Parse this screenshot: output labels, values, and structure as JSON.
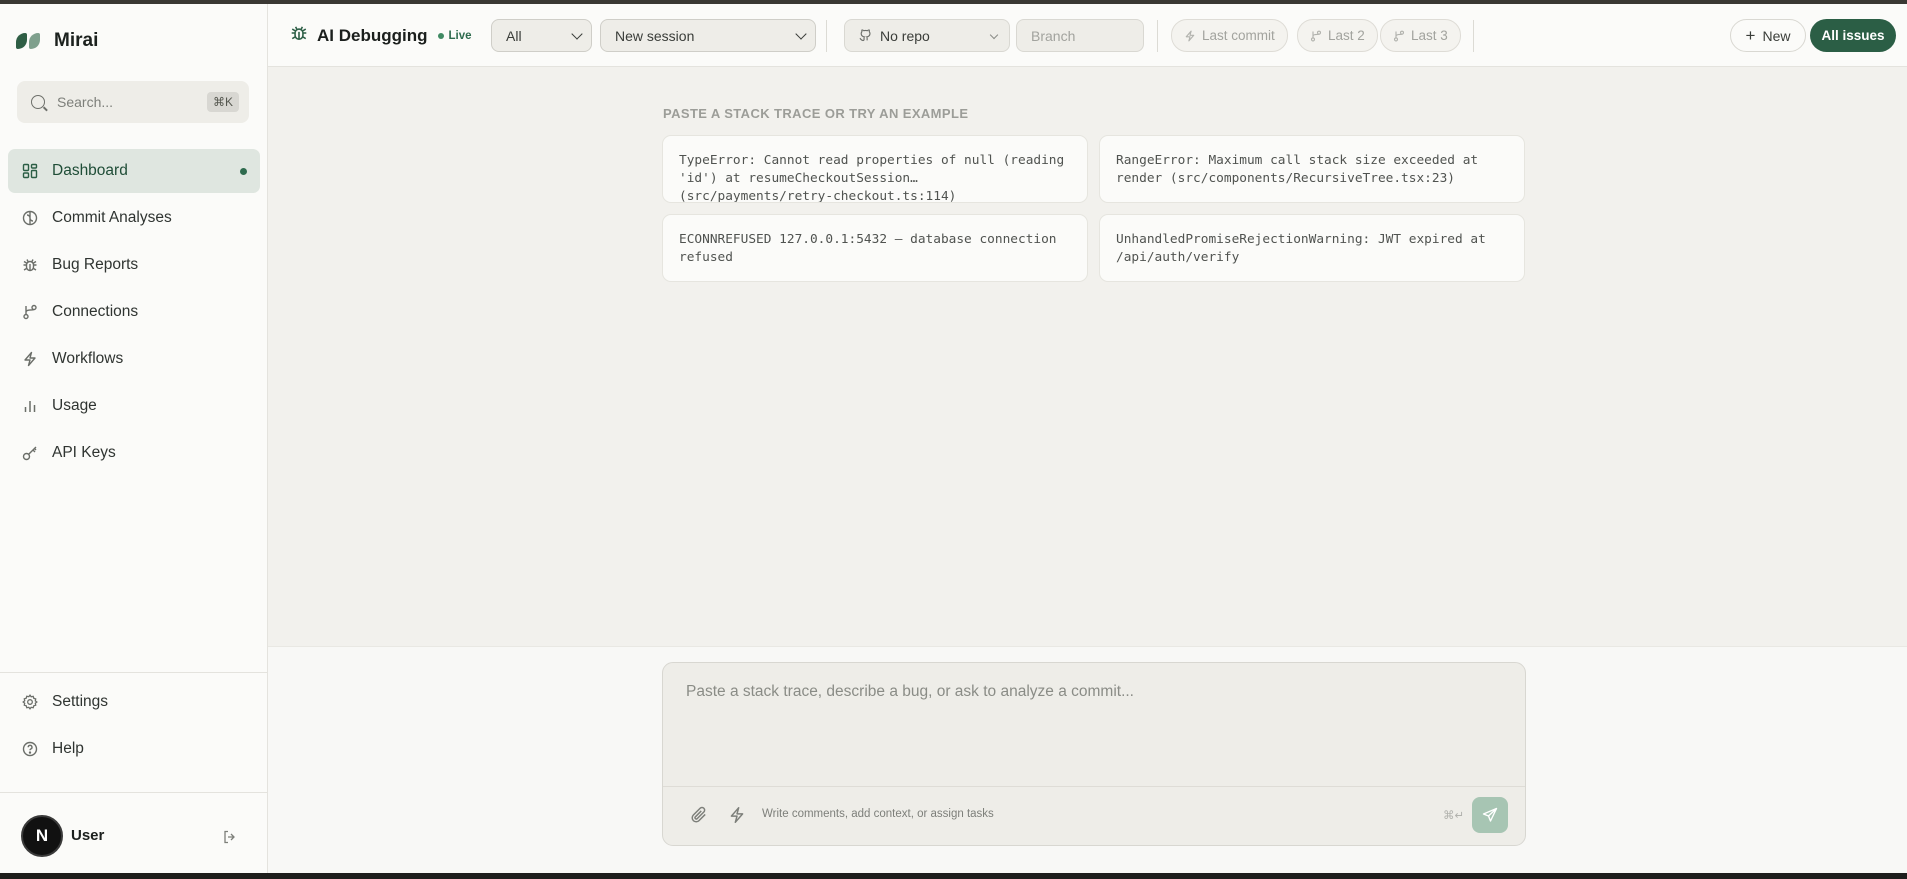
{
  "brand": {
    "name": "Mirai",
    "colors": {
      "accent": "#2b5e45",
      "accent_light": "#7fa08d"
    }
  },
  "search": {
    "placeholder": "Search...",
    "shortcut": "⌘K"
  },
  "sidebar": {
    "items": [
      {
        "label": "Dashboard",
        "icon": "dashboard-icon",
        "active": true
      },
      {
        "label": "Commit Analyses",
        "icon": "commit-analyses-icon",
        "active": false
      },
      {
        "label": "Bug Reports",
        "icon": "bug-icon",
        "active": false
      },
      {
        "label": "Connections",
        "icon": "connections-icon",
        "active": false
      },
      {
        "label": "Workflows",
        "icon": "bolt-icon",
        "active": false
      },
      {
        "label": "Usage",
        "icon": "bar-chart-icon",
        "active": false
      },
      {
        "label": "API Keys",
        "icon": "key-icon",
        "active": false
      }
    ],
    "bottom": [
      {
        "label": "Settings",
        "icon": "gear-icon"
      },
      {
        "label": "Help",
        "icon": "help-icon"
      }
    ],
    "user": {
      "initial": "N",
      "name": "User"
    }
  },
  "header": {
    "title": "AI Debugging",
    "status": "Live",
    "filter_select": "All",
    "session_select": "New session",
    "repo_select": "No repo",
    "branch_placeholder": "Branch",
    "pills": [
      "Last commit",
      "Last 2",
      "Last 3"
    ],
    "new_label": "New",
    "all_issues_label": "All issues"
  },
  "examples": {
    "heading": "PASTE A STACK TRACE OR TRY AN EXAMPLE",
    "cards": [
      "TypeError: Cannot read properties of null (reading 'id') at resumeCheckoutSession… (src/payments/retry-checkout.ts:114)",
      "RangeError: Maximum call stack size exceeded at render (src/components/RecursiveTree.tsx:23)",
      "ECONNREFUSED 127.0.0.1:5432 — database connection refused",
      "UnhandledPromiseRejectionWarning: JWT expired at /api/auth/verify"
    ]
  },
  "composer": {
    "placeholder": "Paste a stack trace, describe a bug, or ask to analyze a commit...",
    "sub_placeholder": "Write comments, add context, or assign tasks",
    "shortcut": "⌘↵"
  }
}
